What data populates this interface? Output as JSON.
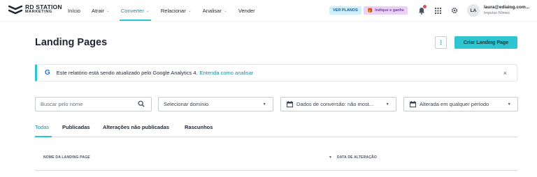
{
  "brand": {
    "line1": "RD STATION",
    "line2": "MARKETING"
  },
  "nav": [
    {
      "label": "Início",
      "has_chevron": false
    },
    {
      "label": "Atrair",
      "has_chevron": true
    },
    {
      "label": "Converter",
      "has_chevron": true,
      "active": true
    },
    {
      "label": "Relacionar",
      "has_chevron": true
    },
    {
      "label": "Analisar",
      "has_chevron": true
    },
    {
      "label": "Vender",
      "has_chevron": false
    }
  ],
  "topbar": {
    "plans_label": "VER PLANOS",
    "indique_label": "Indique e ganhe",
    "icons": [
      "bell-icon",
      "apps-grid-icon",
      "gear-icon"
    ],
    "avatar_initials": "LA",
    "user_email": "laura@edialog.com...",
    "user_company": "Impulso Filmes"
  },
  "page": {
    "title": "Landing Pages",
    "more_icon": "⋮",
    "create_label": "Criar Landing Page"
  },
  "banner": {
    "icon": "G",
    "message": "Este relatório está sendo atualizado pelo Google Analytics 4.",
    "link": "Entenda como analisar",
    "close": "×"
  },
  "filters": {
    "search_placeholder": "Buscar pelo nome",
    "domain_label": "Selecionar domínio",
    "conversion_label": "Dados de conversão: não most...",
    "period_label": "Alterada em qualquer período"
  },
  "tabs": [
    {
      "label": "Todas",
      "active": true
    },
    {
      "label": "Publicadas"
    },
    {
      "label": "Alterações não publicadas"
    },
    {
      "label": "Rascunhos"
    }
  ],
  "table": {
    "col_name": "NOME DA LANDING PAGE",
    "col_date": "DATA DE ALTERAÇÃO"
  },
  "colors": {
    "accent": "#2ec4d0",
    "accent_text": "#1e8a9a",
    "text": "#1e2430"
  }
}
